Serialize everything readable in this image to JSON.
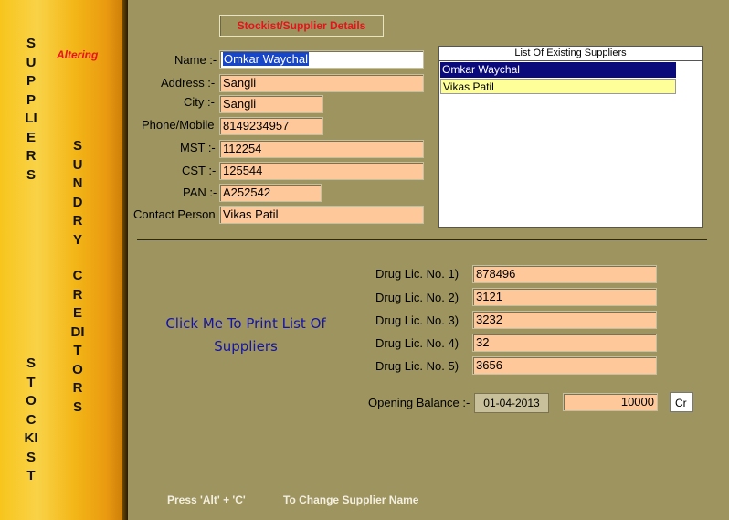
{
  "sidebar": {
    "word_suppliers": "SUPPLIERS",
    "word_sundry": "SUNDRY",
    "word_creditors": "CREDITORS",
    "word_stockist": "STOCKIST",
    "mode_label": "Altering"
  },
  "header": {
    "title": "Stockist/Supplier Details"
  },
  "form": {
    "name_label": "Name :-",
    "name_value": "Omkar Waychal",
    "address_label": "Address :-",
    "address_value": "Sangli",
    "city_label": "City :-",
    "city_value": "Sangli",
    "phone_label": "Phone/Mobile",
    "phone_value": "8149234957",
    "mst_label": "MST :-",
    "mst_value": "112254",
    "cst_label": "CST :-",
    "cst_value": "125544",
    "pan_label": "PAN :-",
    "pan_value": "A252542",
    "contact_label": "Contact Person",
    "contact_value": "Vikas Patil"
  },
  "supplier_list": {
    "header": "List Of Existing Suppliers",
    "items": [
      "Omkar Waychal",
      "Vikas Patil"
    ]
  },
  "drug_licenses": [
    {
      "label": "Drug Lic. No.  1)",
      "value": "878496"
    },
    {
      "label": "Drug Lic. No.  2)",
      "value": "3121"
    },
    {
      "label": "Drug Lic. No.  3)",
      "value": "3232"
    },
    {
      "label": "Drug Lic. No.  4)",
      "value": "32"
    },
    {
      "label": "Drug Lic. No.  5)",
      "value": "3656"
    }
  ],
  "opening_balance": {
    "label": "Opening Balance :-",
    "date": "01-04-2013",
    "amount": "10000",
    "type": "Cr"
  },
  "print_link": {
    "line1": "Click Me To Print List Of",
    "line2": "Suppliers"
  },
  "footer": {
    "shortcut": "Press 'Alt' + 'C'",
    "hint": "To Change Supplier Name"
  },
  "colors": {
    "background": "#9d9460",
    "field": "#ffc89b",
    "accent_red": "#e8121a",
    "link": "#1414a8"
  }
}
